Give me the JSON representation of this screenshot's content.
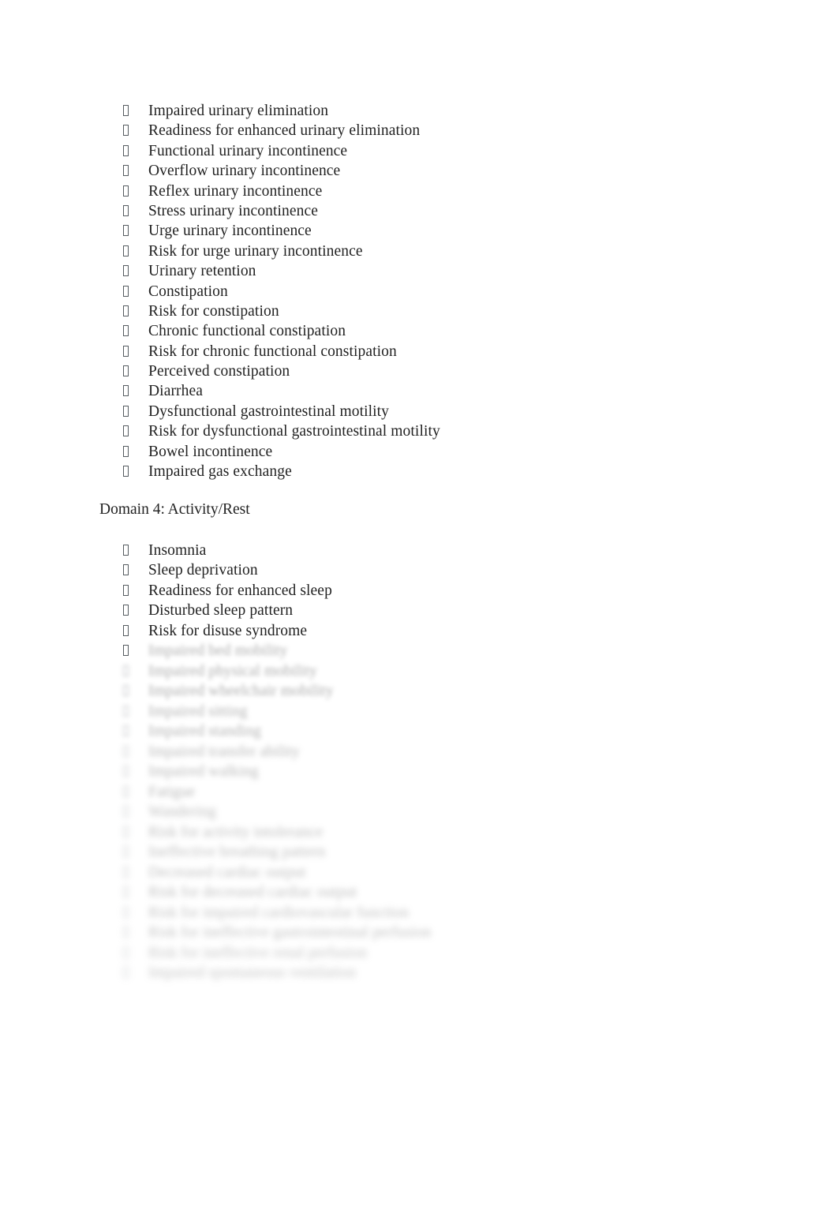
{
  "document": {
    "page_background": "#ffffff",
    "text_color": "#222222",
    "bullet_glyph": "missing-glyph-box",
    "blurred_text_color": "#8c8c8c"
  },
  "domain3_list": {
    "items": [
      "Impaired urinary elimination",
      "Readiness for enhanced urinary elimination",
      "Functional urinary incontinence",
      "Overflow urinary incontinence",
      "Reflex urinary incontinence",
      "Stress urinary incontinence",
      "Urge urinary incontinence",
      "Risk for urge urinary incontinence",
      "Urinary retention",
      "Constipation",
      "Risk for constipation",
      "Chronic functional constipation",
      "Risk for chronic functional constipation",
      "Perceived constipation",
      "Diarrhea",
      "Dysfunctional gastrointestinal motility",
      "Risk for dysfunctional gastrointestinal motility",
      "Bowel incontinence",
      "Impaired gas exchange"
    ]
  },
  "domain4_heading": "Domain 4: Activity/Rest",
  "domain4_list": {
    "items": [
      "Insomnia",
      "Sleep deprivation",
      "Readiness for enhanced sleep",
      "Disturbed sleep pattern",
      "Risk for disuse syndrome"
    ]
  },
  "obscured_list": {
    "note": "text blurred beyond legibility in screenshot",
    "items": [
      "Impaired bed mobility",
      "Impaired physical mobility",
      "Impaired wheelchair mobility",
      "Impaired sitting",
      "Impaired standing",
      "Impaired transfer ability",
      "Impaired walking",
      "Fatigue",
      "Wandering",
      "Risk for activity intolerance",
      "Ineffective breathing pattern",
      "Decreased cardiac output",
      "Risk for decreased cardiac output",
      "Risk for impaired cardiovascular function",
      "Risk for ineffective gastrointestinal perfusion",
      "Risk for ineffective renal perfusion",
      "Impaired spontaneous ventilation"
    ]
  }
}
